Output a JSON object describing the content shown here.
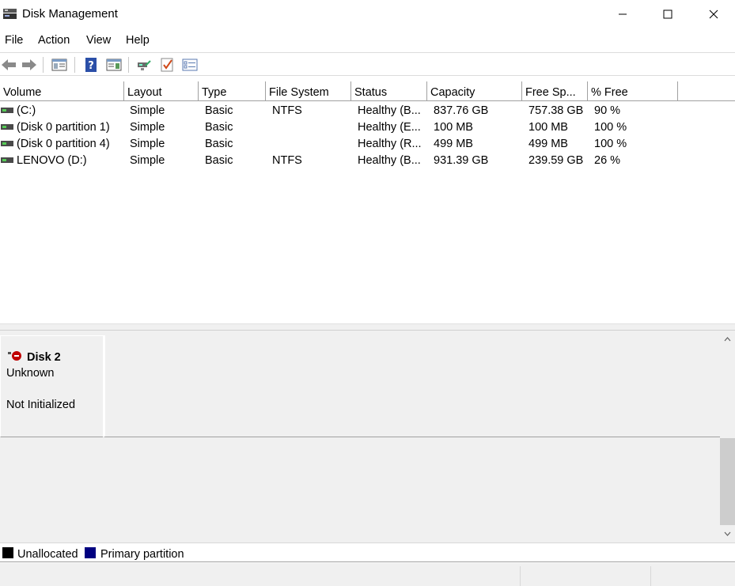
{
  "window": {
    "title": "Disk Management",
    "controls": {
      "minimize": "minimize",
      "maximize": "maximize",
      "close": "close"
    }
  },
  "menu": [
    {
      "label": "File"
    },
    {
      "label": "Action"
    },
    {
      "label": "View"
    },
    {
      "label": "Help"
    }
  ],
  "toolbar": {
    "buttons": [
      "back-arrow-icon",
      "forward-arrow-icon",
      "console-tree-icon",
      "help-icon",
      "action-pane-icon",
      "connect-disk-icon",
      "checklist-icon",
      "properties-icon"
    ]
  },
  "volume_list": {
    "columns": [
      "Volume",
      "Layout",
      "Type",
      "File System",
      "Status",
      "Capacity",
      "Free Sp...",
      "% Free"
    ],
    "rows": [
      {
        "volume": "(C:)",
        "layout": "Simple",
        "type": "Basic",
        "fs": "NTFS",
        "status": "Healthy (B...",
        "capacity": "837.76 GB",
        "free": "757.38 GB",
        "pct": "90 %"
      },
      {
        "volume": "(Disk 0 partition 1)",
        "layout": "Simple",
        "type": "Basic",
        "fs": "",
        "status": "Healthy (E...",
        "capacity": "100 MB",
        "free": "100 MB",
        "pct": "100 %"
      },
      {
        "volume": "(Disk 0 partition 4)",
        "layout": "Simple",
        "type": "Basic",
        "fs": "",
        "status": "Healthy (R...",
        "capacity": "499 MB",
        "free": "499 MB",
        "pct": "100 %"
      },
      {
        "volume": "LENOVO (D:)",
        "layout": "Simple",
        "type": "Basic",
        "fs": "NTFS",
        "status": "Healthy (B...",
        "capacity": "931.39 GB",
        "free": "239.59 GB",
        "pct": "26 %"
      }
    ]
  },
  "disks": [
    {
      "name": "Disk 2",
      "type": "Unknown",
      "status": "Not Initialized"
    }
  ],
  "legend": [
    {
      "label": "Unallocated",
      "color": "#000000"
    },
    {
      "label": "Primary partition",
      "color": "#000080"
    }
  ],
  "colors": {
    "accent_primary": "#000080",
    "unallocated": "#000000",
    "error_red": "#c00000"
  }
}
